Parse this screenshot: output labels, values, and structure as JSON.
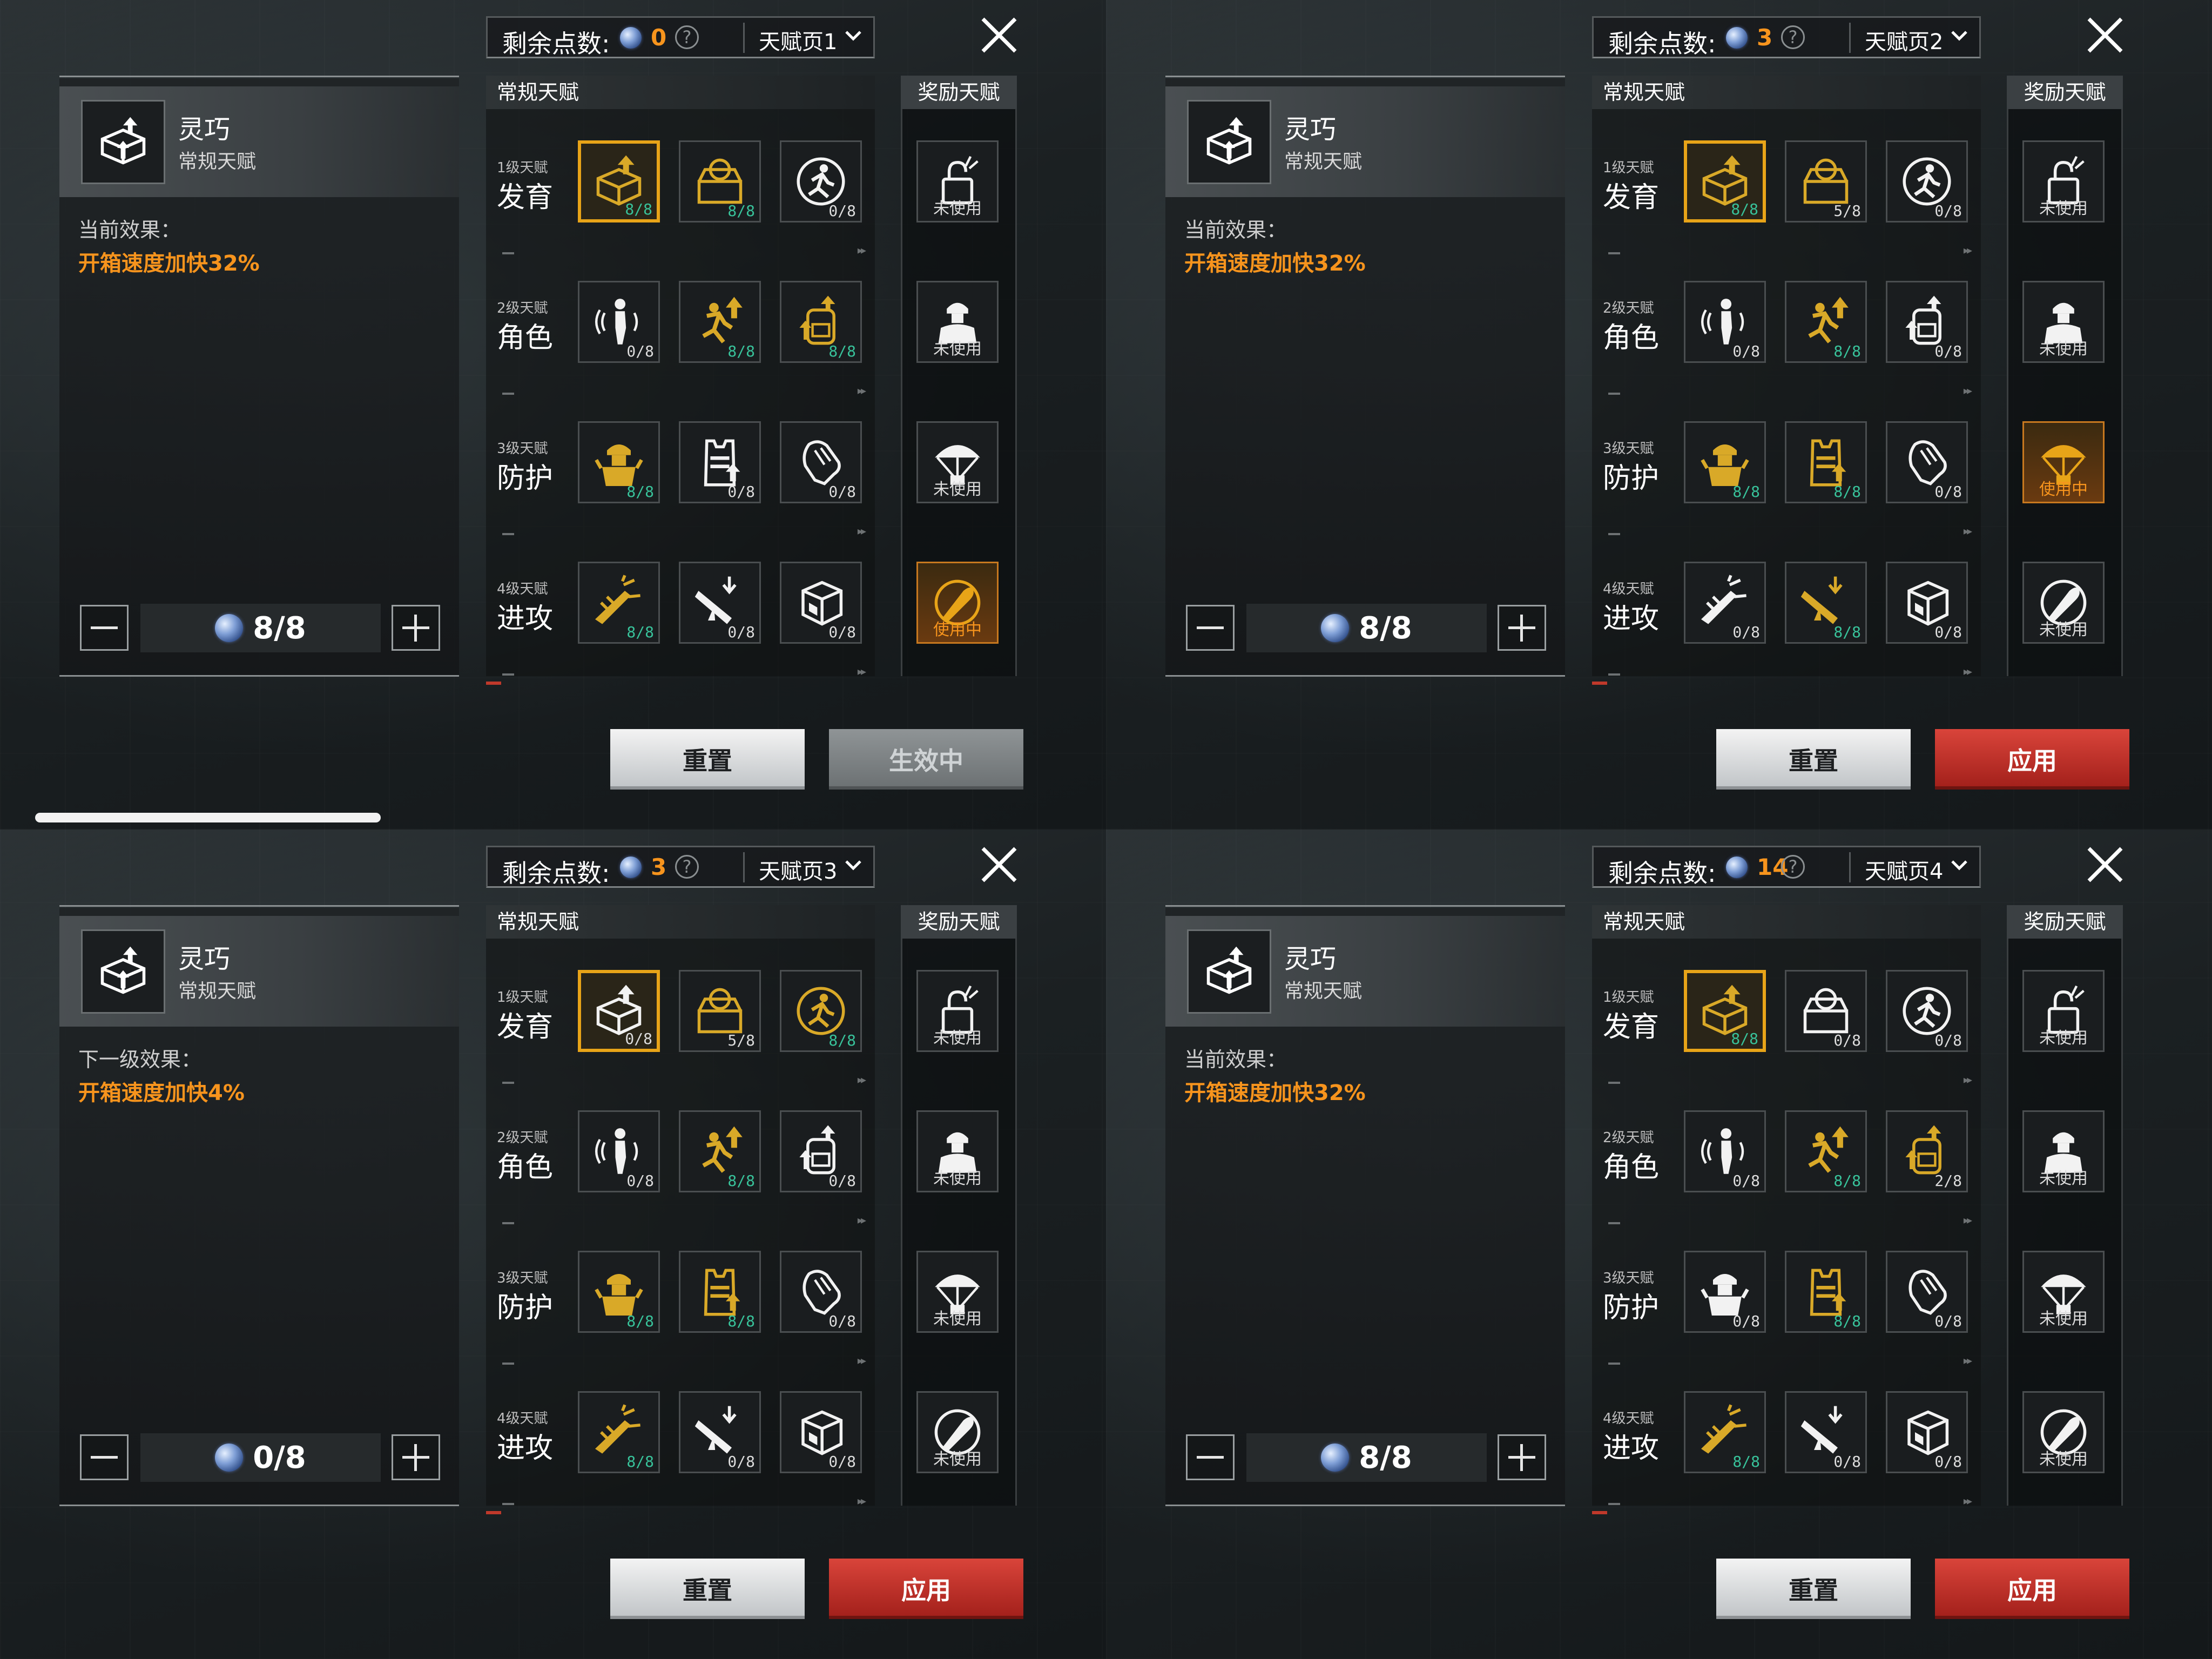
{
  "colors": {
    "accent_orange": "#f7941d",
    "max_green": "#38c29a",
    "apply_red": "#c0392b",
    "gold_border": "#e8a418"
  },
  "panels": [
    {
      "remaining_label": "剩余点数:",
      "remaining_points": "0",
      "help_icon": "question-circle-icon",
      "page_label": "天赋页1",
      "regular_header": "常规天赋",
      "bonus_header": "奖励天赋",
      "info": {
        "name": "灵巧",
        "type": "常规天赋",
        "effect_label": "当前效果：",
        "effect_value": "开箱速度加快32%",
        "stepper_value": "8/8"
      },
      "rows": [
        {
          "level": "1级天赋",
          "name": "发育",
          "talents": [
            {
              "icon": "box-up-icon",
              "count": "8/8",
              "gold": true,
              "selected": true
            },
            {
              "icon": "open-box-icon",
              "count": "8/8",
              "gold": true
            },
            {
              "icon": "runner-circle-icon",
              "count": "0/8",
              "gold": false
            }
          ],
          "bonus": {
            "icon": "lock-icon",
            "status": "未使用",
            "active": false
          }
        },
        {
          "level": "2级天赋",
          "name": "角色",
          "talents": [
            {
              "icon": "sound-soldier-icon",
              "count": "0/8",
              "gold": false
            },
            {
              "icon": "sprint-up-icon",
              "count": "8/8",
              "gold": true
            },
            {
              "icon": "backpack-up-icon",
              "count": "8/8",
              "gold": true
            }
          ],
          "bonus": {
            "icon": "soldier-bust-icon",
            "status": "未使用",
            "active": false
          }
        },
        {
          "level": "3级天赋",
          "name": "防护",
          "talents": [
            {
              "icon": "helmet-soldier-icon",
              "count": "8/8",
              "gold": true
            },
            {
              "icon": "vest-up-icon",
              "count": "0/8",
              "gold": false
            },
            {
              "icon": "glove-icon",
              "count": "0/8",
              "gold": false
            }
          ],
          "bonus": {
            "icon": "parachute-icon",
            "status": "未使用",
            "active": false
          }
        },
        {
          "level": "4级天赋",
          "name": "进攻",
          "talents": [
            {
              "icon": "rifle-burst-icon",
              "count": "8/8",
              "gold": true
            },
            {
              "icon": "rifle-down-icon",
              "count": "0/8",
              "gold": false
            },
            {
              "icon": "crate-icon",
              "count": "0/8",
              "gold": false
            }
          ],
          "bonus": {
            "icon": "bullet-icon",
            "status": "使用中",
            "active": true
          }
        }
      ],
      "reset_label": "重置",
      "apply_label": "生效中",
      "apply_disabled": true
    },
    {
      "remaining_label": "剩余点数:",
      "remaining_points": "3",
      "help_icon": "question-circle-icon",
      "page_label": "天赋页2",
      "regular_header": "常规天赋",
      "bonus_header": "奖励天赋",
      "info": {
        "name": "灵巧",
        "type": "常规天赋",
        "effect_label": "当前效果：",
        "effect_value": "开箱速度加快32%",
        "stepper_value": "8/8"
      },
      "rows": [
        {
          "level": "1级天赋",
          "name": "发育",
          "talents": [
            {
              "icon": "box-up-icon",
              "count": "8/8",
              "gold": true,
              "selected": true
            },
            {
              "icon": "open-box-icon",
              "count": "5/8",
              "gold": true
            },
            {
              "icon": "runner-circle-icon",
              "count": "0/8",
              "gold": false
            }
          ],
          "bonus": {
            "icon": "lock-icon",
            "status": "未使用",
            "active": false
          }
        },
        {
          "level": "2级天赋",
          "name": "角色",
          "talents": [
            {
              "icon": "sound-soldier-icon",
              "count": "0/8",
              "gold": false
            },
            {
              "icon": "sprint-up-icon",
              "count": "8/8",
              "gold": true
            },
            {
              "icon": "backpack-up-icon",
              "count": "0/8",
              "gold": false
            }
          ],
          "bonus": {
            "icon": "soldier-bust-icon",
            "status": "未使用",
            "active": false
          }
        },
        {
          "level": "3级天赋",
          "name": "防护",
          "talents": [
            {
              "icon": "helmet-soldier-icon",
              "count": "8/8",
              "gold": true
            },
            {
              "icon": "vest-up-icon",
              "count": "8/8",
              "gold": true
            },
            {
              "icon": "glove-icon",
              "count": "0/8",
              "gold": false
            }
          ],
          "bonus": {
            "icon": "parachute-icon",
            "status": "使用中",
            "active": true
          }
        },
        {
          "level": "4级天赋",
          "name": "进攻",
          "talents": [
            {
              "icon": "rifle-burst-icon",
              "count": "0/8",
              "gold": false
            },
            {
              "icon": "rifle-down-icon",
              "count": "8/8",
              "gold": true
            },
            {
              "icon": "crate-icon",
              "count": "0/8",
              "gold": false
            }
          ],
          "bonus": {
            "icon": "bullet-icon",
            "status": "未使用",
            "active": false
          }
        }
      ],
      "reset_label": "重置",
      "apply_label": "应用",
      "apply_disabled": false
    },
    {
      "remaining_label": "剩余点数:",
      "remaining_points": "3",
      "help_icon": "question-circle-icon",
      "page_label": "天赋页3",
      "regular_header": "常规天赋",
      "bonus_header": "奖励天赋",
      "info": {
        "name": "灵巧",
        "type": "常规天赋",
        "effect_label": "下一级效果：",
        "effect_value": "开箱速度加快4%",
        "stepper_value": "0/8"
      },
      "rows": [
        {
          "level": "1级天赋",
          "name": "发育",
          "talents": [
            {
              "icon": "box-up-icon",
              "count": "0/8",
              "gold": false,
              "selected": true
            },
            {
              "icon": "open-box-icon",
              "count": "5/8",
              "gold": true
            },
            {
              "icon": "runner-circle-icon",
              "count": "8/8",
              "gold": true
            }
          ],
          "bonus": {
            "icon": "lock-icon",
            "status": "未使用",
            "active": false
          }
        },
        {
          "level": "2级天赋",
          "name": "角色",
          "talents": [
            {
              "icon": "sound-soldier-icon",
              "count": "0/8",
              "gold": false
            },
            {
              "icon": "sprint-up-icon",
              "count": "8/8",
              "gold": true
            },
            {
              "icon": "backpack-up-icon",
              "count": "0/8",
              "gold": false
            }
          ],
          "bonus": {
            "icon": "soldier-bust-icon",
            "status": "未使用",
            "active": false
          }
        },
        {
          "level": "3级天赋",
          "name": "防护",
          "talents": [
            {
              "icon": "helmet-soldier-icon",
              "count": "8/8",
              "gold": true
            },
            {
              "icon": "vest-up-icon",
              "count": "8/8",
              "gold": true
            },
            {
              "icon": "glove-icon",
              "count": "0/8",
              "gold": false
            }
          ],
          "bonus": {
            "icon": "parachute-icon",
            "status": "未使用",
            "active": false
          }
        },
        {
          "level": "4级天赋",
          "name": "进攻",
          "talents": [
            {
              "icon": "rifle-burst-icon",
              "count": "8/8",
              "gold": true
            },
            {
              "icon": "rifle-down-icon",
              "count": "0/8",
              "gold": false
            },
            {
              "icon": "crate-icon",
              "count": "0/8",
              "gold": false
            }
          ],
          "bonus": {
            "icon": "bullet-icon",
            "status": "未使用",
            "active": false
          }
        }
      ],
      "reset_label": "重置",
      "apply_label": "应用",
      "apply_disabled": false
    },
    {
      "remaining_label": "剩余点数:",
      "remaining_points": "14",
      "help_icon": "question-circle-icon",
      "page_label": "天赋页4",
      "regular_header": "常规天赋",
      "bonus_header": "奖励天赋",
      "info": {
        "name": "灵巧",
        "type": "常规天赋",
        "effect_label": "当前效果：",
        "effect_value": "开箱速度加快32%",
        "stepper_value": "8/8"
      },
      "rows": [
        {
          "level": "1级天赋",
          "name": "发育",
          "talents": [
            {
              "icon": "box-up-icon",
              "count": "8/8",
              "gold": true,
              "selected": true
            },
            {
              "icon": "open-box-icon",
              "count": "0/8",
              "gold": false
            },
            {
              "icon": "runner-circle-icon",
              "count": "0/8",
              "gold": false
            }
          ],
          "bonus": {
            "icon": "lock-icon",
            "status": "未使用",
            "active": false
          }
        },
        {
          "level": "2级天赋",
          "name": "角色",
          "talents": [
            {
              "icon": "sound-soldier-icon",
              "count": "0/8",
              "gold": false
            },
            {
              "icon": "sprint-up-icon",
              "count": "8/8",
              "gold": true
            },
            {
              "icon": "backpack-up-icon",
              "count": "2/8",
              "gold": true
            }
          ],
          "bonus": {
            "icon": "soldier-bust-icon",
            "status": "未使用",
            "active": false
          }
        },
        {
          "level": "3级天赋",
          "name": "防护",
          "talents": [
            {
              "icon": "helmet-soldier-icon",
              "count": "0/8",
              "gold": false
            },
            {
              "icon": "vest-up-icon",
              "count": "8/8",
              "gold": true
            },
            {
              "icon": "glove-icon",
              "count": "0/8",
              "gold": false
            }
          ],
          "bonus": {
            "icon": "parachute-icon",
            "status": "未使用",
            "active": false
          }
        },
        {
          "level": "4级天赋",
          "name": "进攻",
          "talents": [
            {
              "icon": "rifle-burst-icon",
              "count": "8/8",
              "gold": true
            },
            {
              "icon": "rifle-down-icon",
              "count": "0/8",
              "gold": false
            },
            {
              "icon": "crate-icon",
              "count": "0/8",
              "gold": false
            }
          ],
          "bonus": {
            "icon": "bullet-icon",
            "status": "未使用",
            "active": false
          }
        }
      ],
      "reset_label": "重置",
      "apply_label": "应用",
      "apply_disabled": false
    }
  ]
}
